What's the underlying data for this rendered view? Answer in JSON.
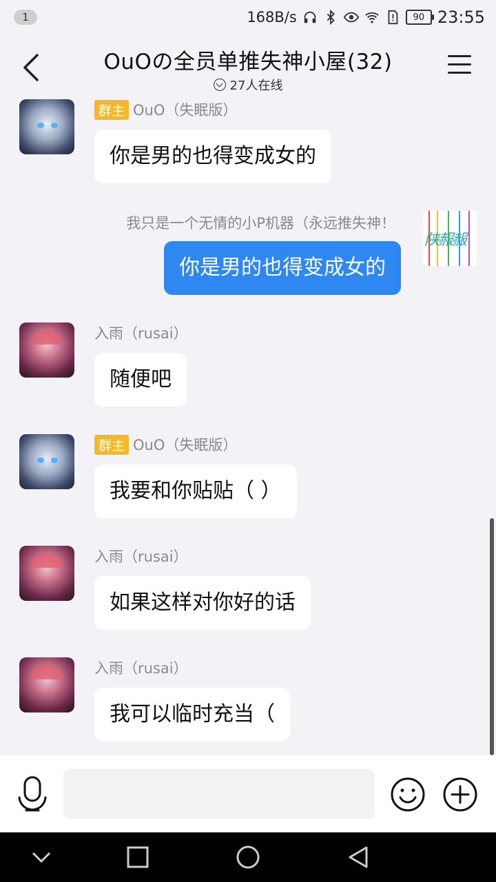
{
  "status_bar": {
    "notification_count": "1",
    "net_speed": "168B/s",
    "battery": "90",
    "time": "23:55"
  },
  "header": {
    "title": "OuOの全员单推失神小屋(32)",
    "online_text": "27人在线"
  },
  "messages": [
    {
      "sender": "OuO（失眠版）",
      "badge": "群主",
      "text": "你是男的也得变成女的"
    },
    {
      "sender": "我只是一个无情的小P机器（永远推失神！",
      "text": "你是男的也得变成女的",
      "self_avatar_text": "陕赧赧"
    },
    {
      "sender": "入雨（rusai）",
      "text": "随便吧"
    },
    {
      "sender": "OuO（失眠版）",
      "badge": "群主",
      "text": "我要和你贴贴（ ）"
    },
    {
      "sender": "入雨（rusai）",
      "text": "如果这样对你好的话"
    },
    {
      "sender": "入雨（rusai）",
      "text": "我可以临时充当（"
    }
  ],
  "input": {
    "value": "",
    "placeholder": ""
  },
  "colors": {
    "self_bubble": "#2f87f2",
    "owner_badge": "#f6b72a",
    "background": "#f2f2f7"
  },
  "icons": [
    "back-arrow-icon",
    "menu-icon",
    "online-icon",
    "microphone-icon",
    "emoji-icon",
    "plus-icon",
    "nav-back-icon",
    "nav-home-icon",
    "nav-recents-icon",
    "nav-collapse-icon"
  ]
}
